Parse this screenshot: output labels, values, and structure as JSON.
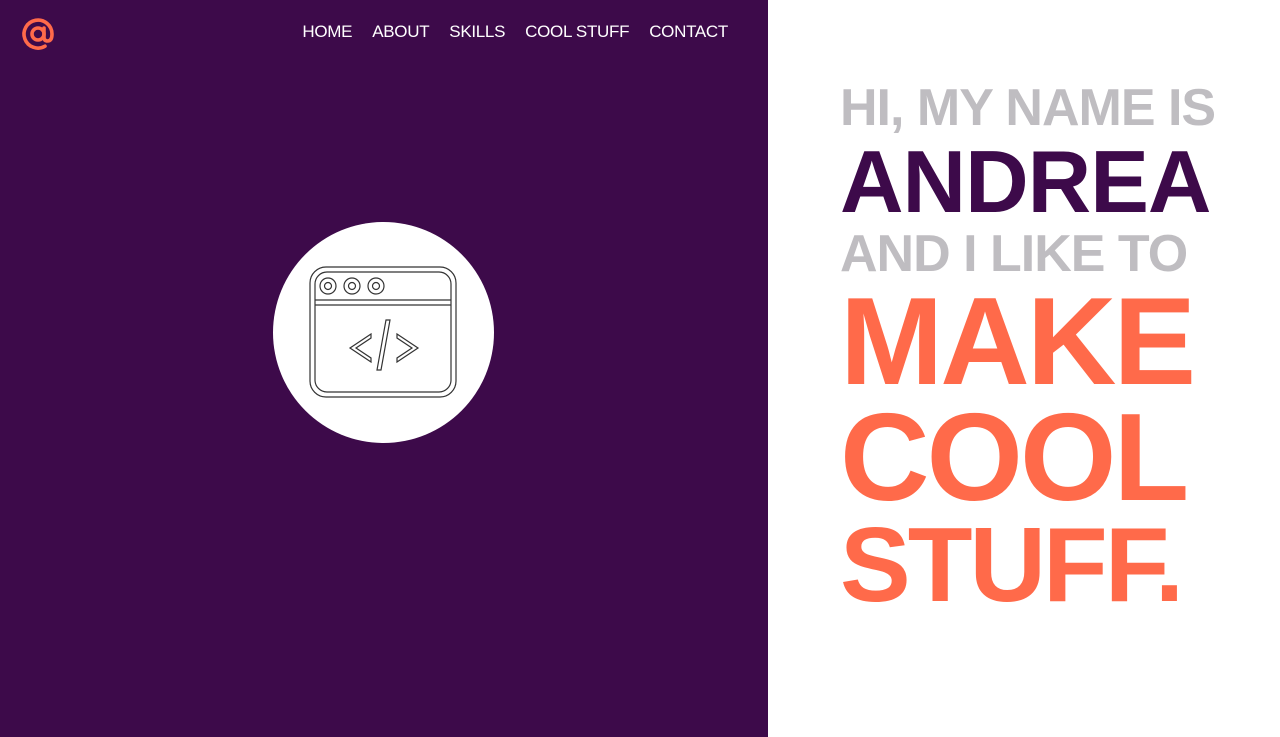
{
  "logo": {
    "icon": "at-sign-icon",
    "color": "#ff6a4a"
  },
  "nav": {
    "items": [
      {
        "label": "HOME"
      },
      {
        "label": "ABOUT"
      },
      {
        "label": "SKILLS"
      },
      {
        "label": "COOL STUFF"
      },
      {
        "label": "CONTACT"
      }
    ]
  },
  "hero": {
    "icon": "code-window-icon"
  },
  "headline": {
    "line1": "HI, MY NAME IS",
    "name": "ANDREA",
    "line3": "AND I LIKE TO",
    "line4": "MAKE",
    "line5": "COOL",
    "line6": "STUFF."
  },
  "colors": {
    "purple": "#3d0a4a",
    "accent": "#ff6a4a",
    "grey": "#bfbdc1",
    "white": "#ffffff"
  }
}
